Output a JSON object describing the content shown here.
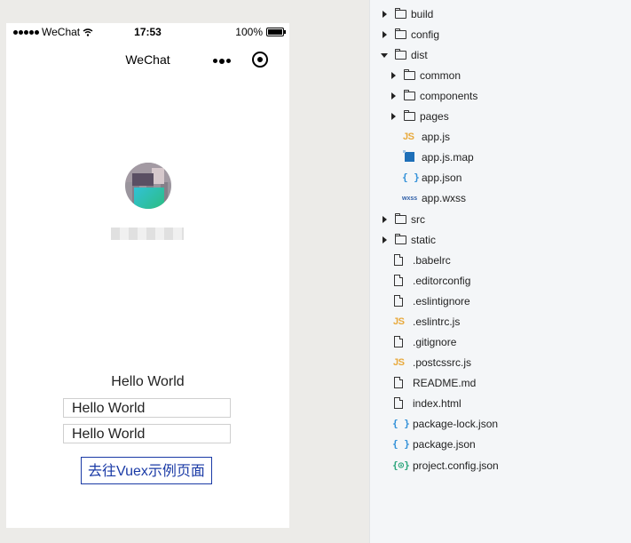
{
  "phone": {
    "status_bar": {
      "carrier": "WeChat",
      "time": "17:53",
      "battery": "100%"
    },
    "nav_title": "WeChat",
    "hello_text": "Hello World",
    "input_1_value": "Hello World",
    "input_2_value": "Hello World",
    "vuex_button_label": "去往Vuex示例页面"
  },
  "file_tree": {
    "items": [
      {
        "label": "build",
        "type": "folder",
        "expanded": false
      },
      {
        "label": "config",
        "type": "folder",
        "expanded": false
      },
      {
        "label": "dist",
        "type": "folder",
        "expanded": true
      },
      {
        "label": "common",
        "type": "folder",
        "expanded": false
      },
      {
        "label": "components",
        "type": "folder",
        "expanded": false
      },
      {
        "label": "pages",
        "type": "folder",
        "expanded": false
      },
      {
        "label": "app.js",
        "type": "js"
      },
      {
        "label": "app.js.map",
        "type": "map"
      },
      {
        "label": "app.json",
        "type": "json"
      },
      {
        "label": "app.wxss",
        "type": "wxss"
      },
      {
        "label": "src",
        "type": "folder",
        "expanded": false
      },
      {
        "label": "static",
        "type": "folder",
        "expanded": false
      },
      {
        "label": ".babelrc",
        "type": "file"
      },
      {
        "label": ".editorconfig",
        "type": "file"
      },
      {
        "label": ".eslintignore",
        "type": "file"
      },
      {
        "label": ".eslintrc.js",
        "type": "js"
      },
      {
        "label": ".gitignore",
        "type": "file"
      },
      {
        "label": ".postcssrc.js",
        "type": "js"
      },
      {
        "label": "README.md",
        "type": "file"
      },
      {
        "label": "index.html",
        "type": "file"
      },
      {
        "label": "package-lock.json",
        "type": "json"
      },
      {
        "label": "package.json",
        "type": "json"
      },
      {
        "label": "project.config.json",
        "type": "project"
      }
    ],
    "icon_glyphs": {
      "js": "JS",
      "json": "{ }",
      "wxss": "wxss",
      "project": "{⊙}"
    }
  },
  "colors": {
    "button_blue": "#1a3aa6",
    "js_icon": "#e8a93b",
    "json_icon": "#2f8fd8",
    "map_icon": "#1e6fb8",
    "project_icon": "#2aa57a"
  }
}
